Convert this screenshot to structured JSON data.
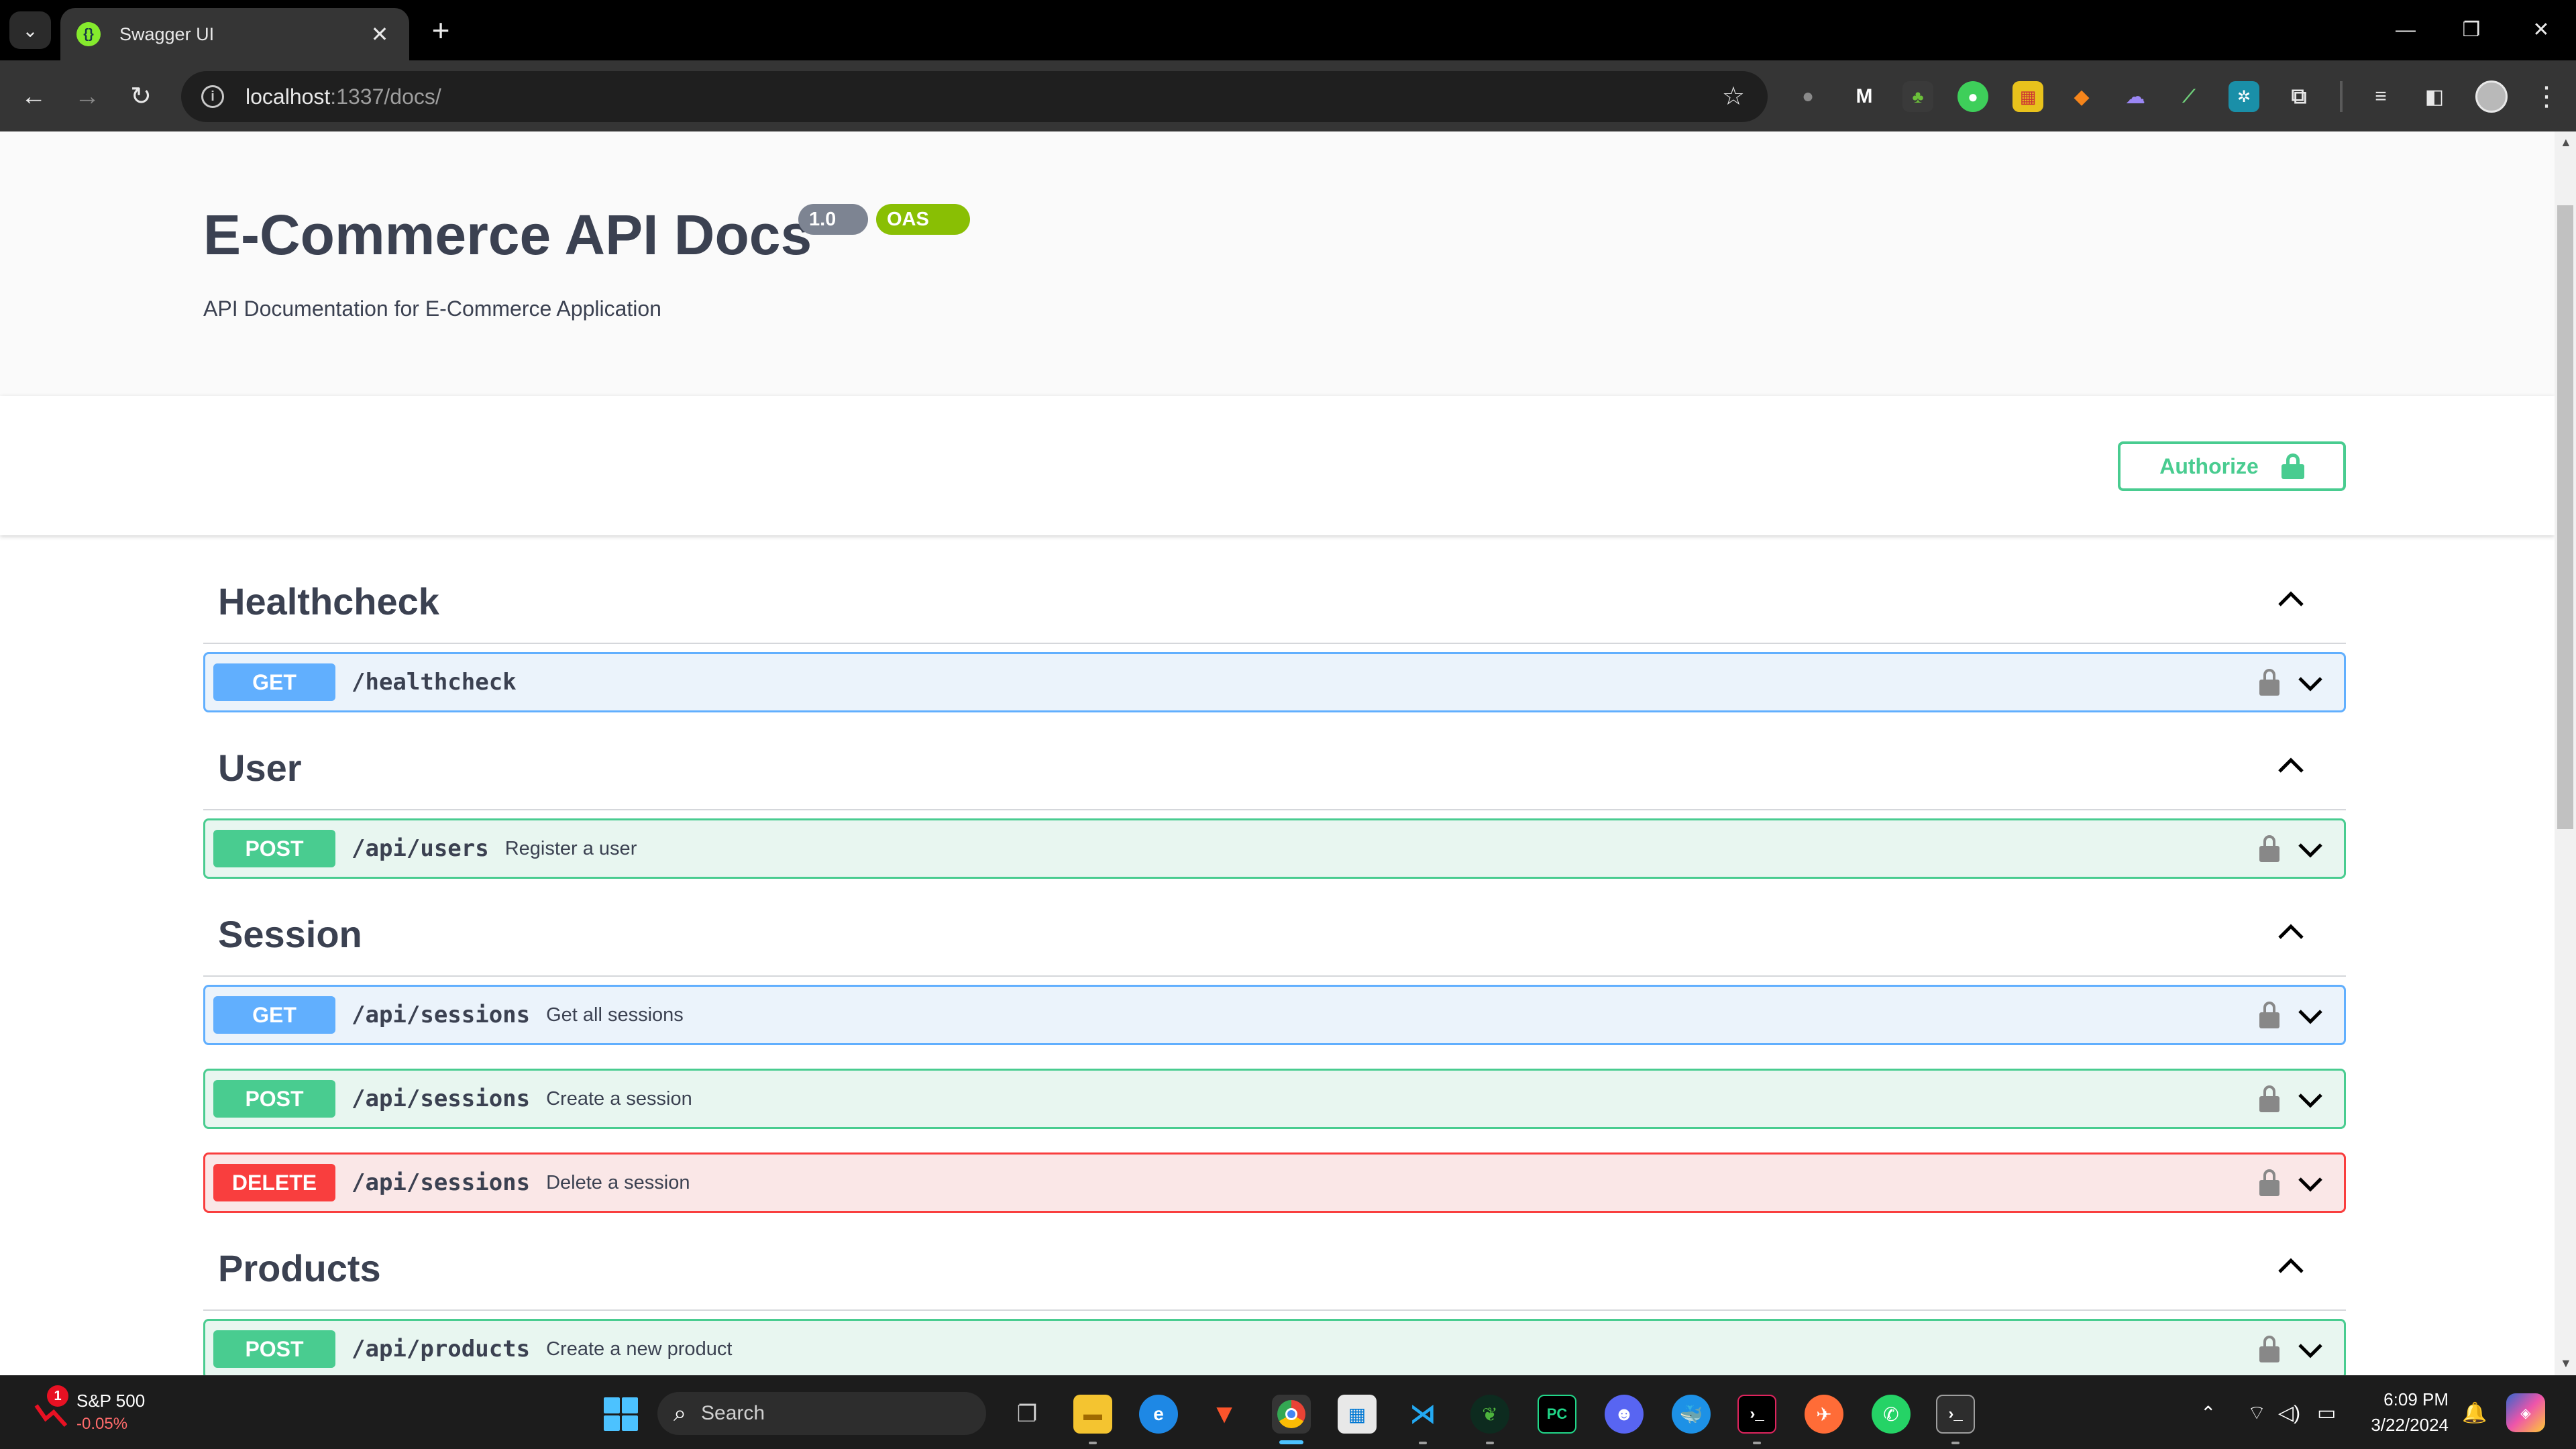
{
  "browser": {
    "tab_title": "Swagger UI",
    "new_tab": "+",
    "url_host": "localhost",
    "url_rest": ":1337/docs/",
    "window_controls": {
      "minimize": "—",
      "restore": "❐",
      "close": "✕"
    }
  },
  "header": {
    "title": "E-Commerce API Docs",
    "version_badge": "1.0",
    "oas_badge": "OAS",
    "description": "API Documentation for E-Commerce Application"
  },
  "authorize": {
    "label": "Authorize"
  },
  "sections": [
    {
      "name": "Healthcheck",
      "ops": [
        {
          "method": "GET",
          "path": "/healthcheck",
          "summary": ""
        }
      ]
    },
    {
      "name": "User",
      "ops": [
        {
          "method": "POST",
          "path": "/api/users",
          "summary": "Register a user"
        }
      ]
    },
    {
      "name": "Session",
      "ops": [
        {
          "method": "GET",
          "path": "/api/sessions",
          "summary": "Get all sessions"
        },
        {
          "method": "POST",
          "path": "/api/sessions",
          "summary": "Create a session"
        },
        {
          "method": "DELETE",
          "path": "/api/sessions",
          "summary": "Delete a session"
        }
      ]
    },
    {
      "name": "Products",
      "ops": [
        {
          "method": "POST",
          "path": "/api/products",
          "summary": "Create a new product"
        }
      ]
    }
  ],
  "taskbar": {
    "widget_name": "S&P 500",
    "widget_value": "-0.05%",
    "widget_badge": "1",
    "search_label": "Search",
    "time": "6:09 PM",
    "date": "3/22/2024"
  },
  "colors": {
    "get": "#61affe",
    "post": "#49cc90",
    "delete": "#f93e3e",
    "title": "#3b4151",
    "authorize": "#49cc90"
  }
}
